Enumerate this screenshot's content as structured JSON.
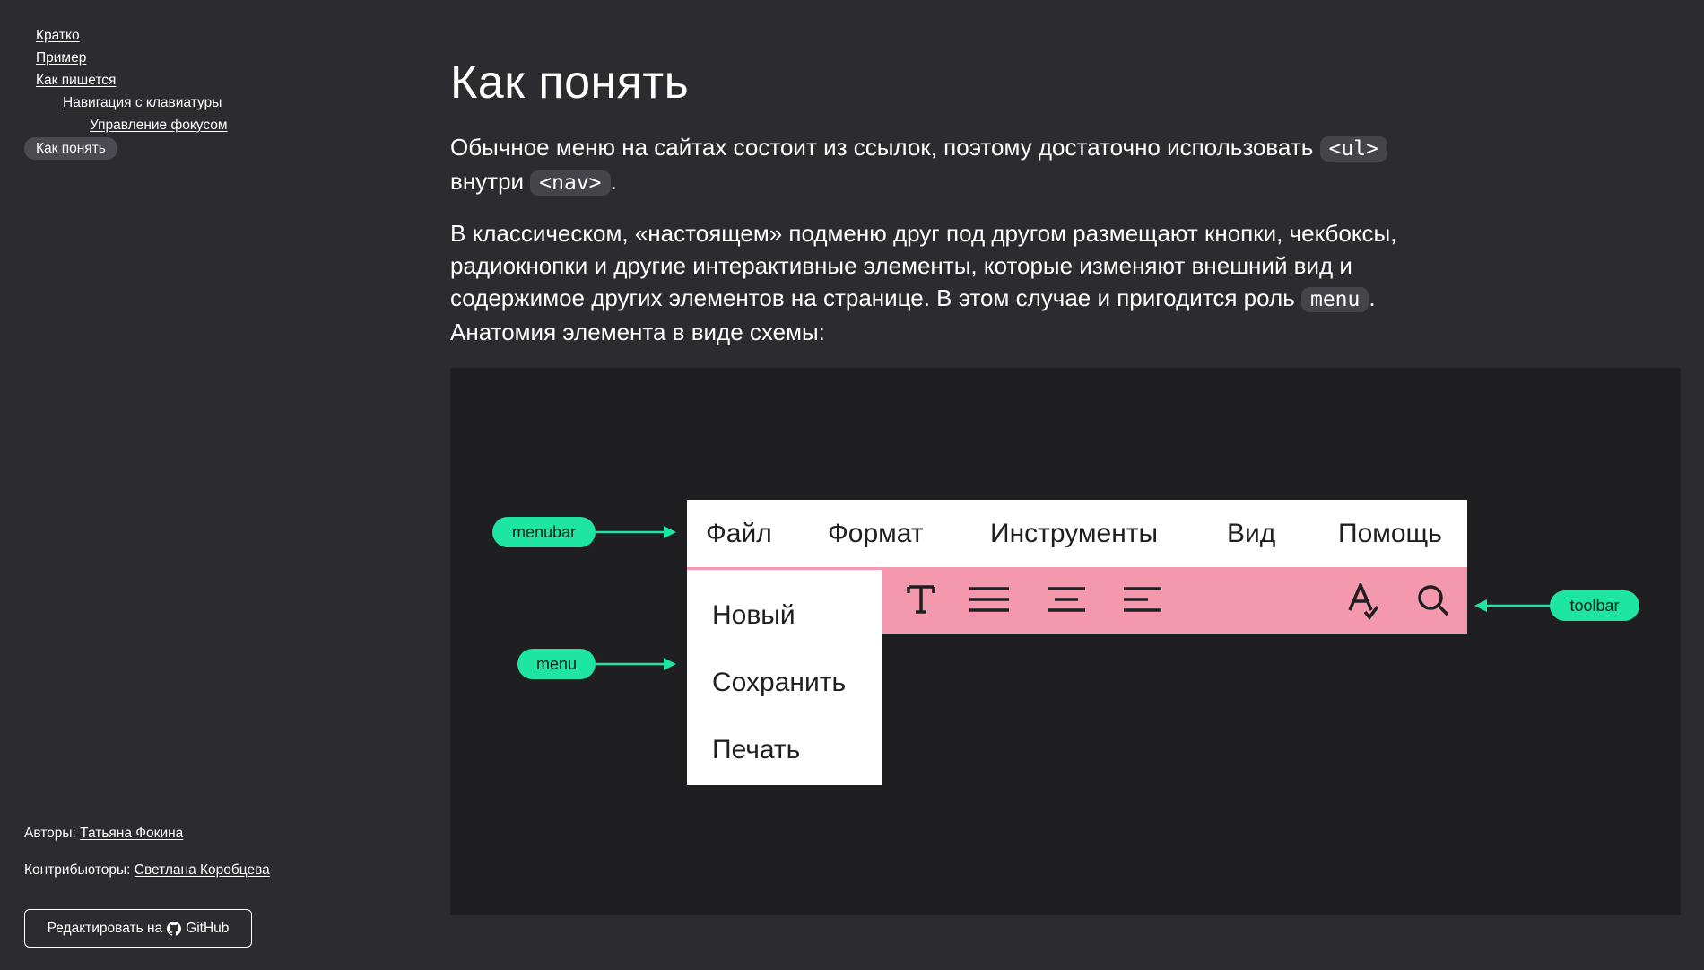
{
  "toc": {
    "items": [
      {
        "label": "Кратко"
      },
      {
        "label": "Пример"
      },
      {
        "label": "Как пишется"
      },
      {
        "label": "Навигация с клавиатуры"
      },
      {
        "label": "Управление фокусом"
      },
      {
        "label": "Как понять"
      }
    ]
  },
  "footer": {
    "authors_label": "Авторы:",
    "authors_name": "Татьяна Фокина",
    "contributors_label": "Контрибьюторы:",
    "contributors_name": "Светлана Коробцева",
    "edit_label": "Редактировать на",
    "edit_platform": "GitHub"
  },
  "main": {
    "title": "Как понять",
    "para1_before": "Обычное меню на сайтах состоит из ссылок, поэтому достаточно использовать ",
    "para1_code1": "<ul>",
    "para1_middle": " внутри ",
    "para1_code2": "<nav>",
    "para1_after": ".",
    "para2_before": "В классическом, «настоящем» подменю друг под другом размещают кнопки, чекбоксы, радиокнопки и другие интерактивные элементы, которые изменяют внешний вид и содержимое других элементов на странице. В этом случае и пригодится роль ",
    "para2_code": "menu",
    "para2_after": ".",
    "para2_tail": "Анатомия элемента в виде схемы:"
  },
  "diagram": {
    "menubar_items": [
      "Файл",
      "Формат",
      "Инструменты",
      "Вид",
      "Помощь"
    ],
    "menu_items": [
      "Новый",
      "Сохранить",
      "Печать"
    ],
    "labels": {
      "menubar": "menubar",
      "menu": "menu",
      "toolbar": "toolbar"
    },
    "toolbar_icons": [
      "text-format-icon",
      "align-justify-icon",
      "align-center-icon",
      "align-left-icon",
      "spellcheck-icon",
      "search-icon"
    ],
    "colors": {
      "accent": "#1ee6a2",
      "toolbar": "#f398ad",
      "figure_bg": "#1f1f22",
      "page_bg": "#2b2b30"
    }
  }
}
